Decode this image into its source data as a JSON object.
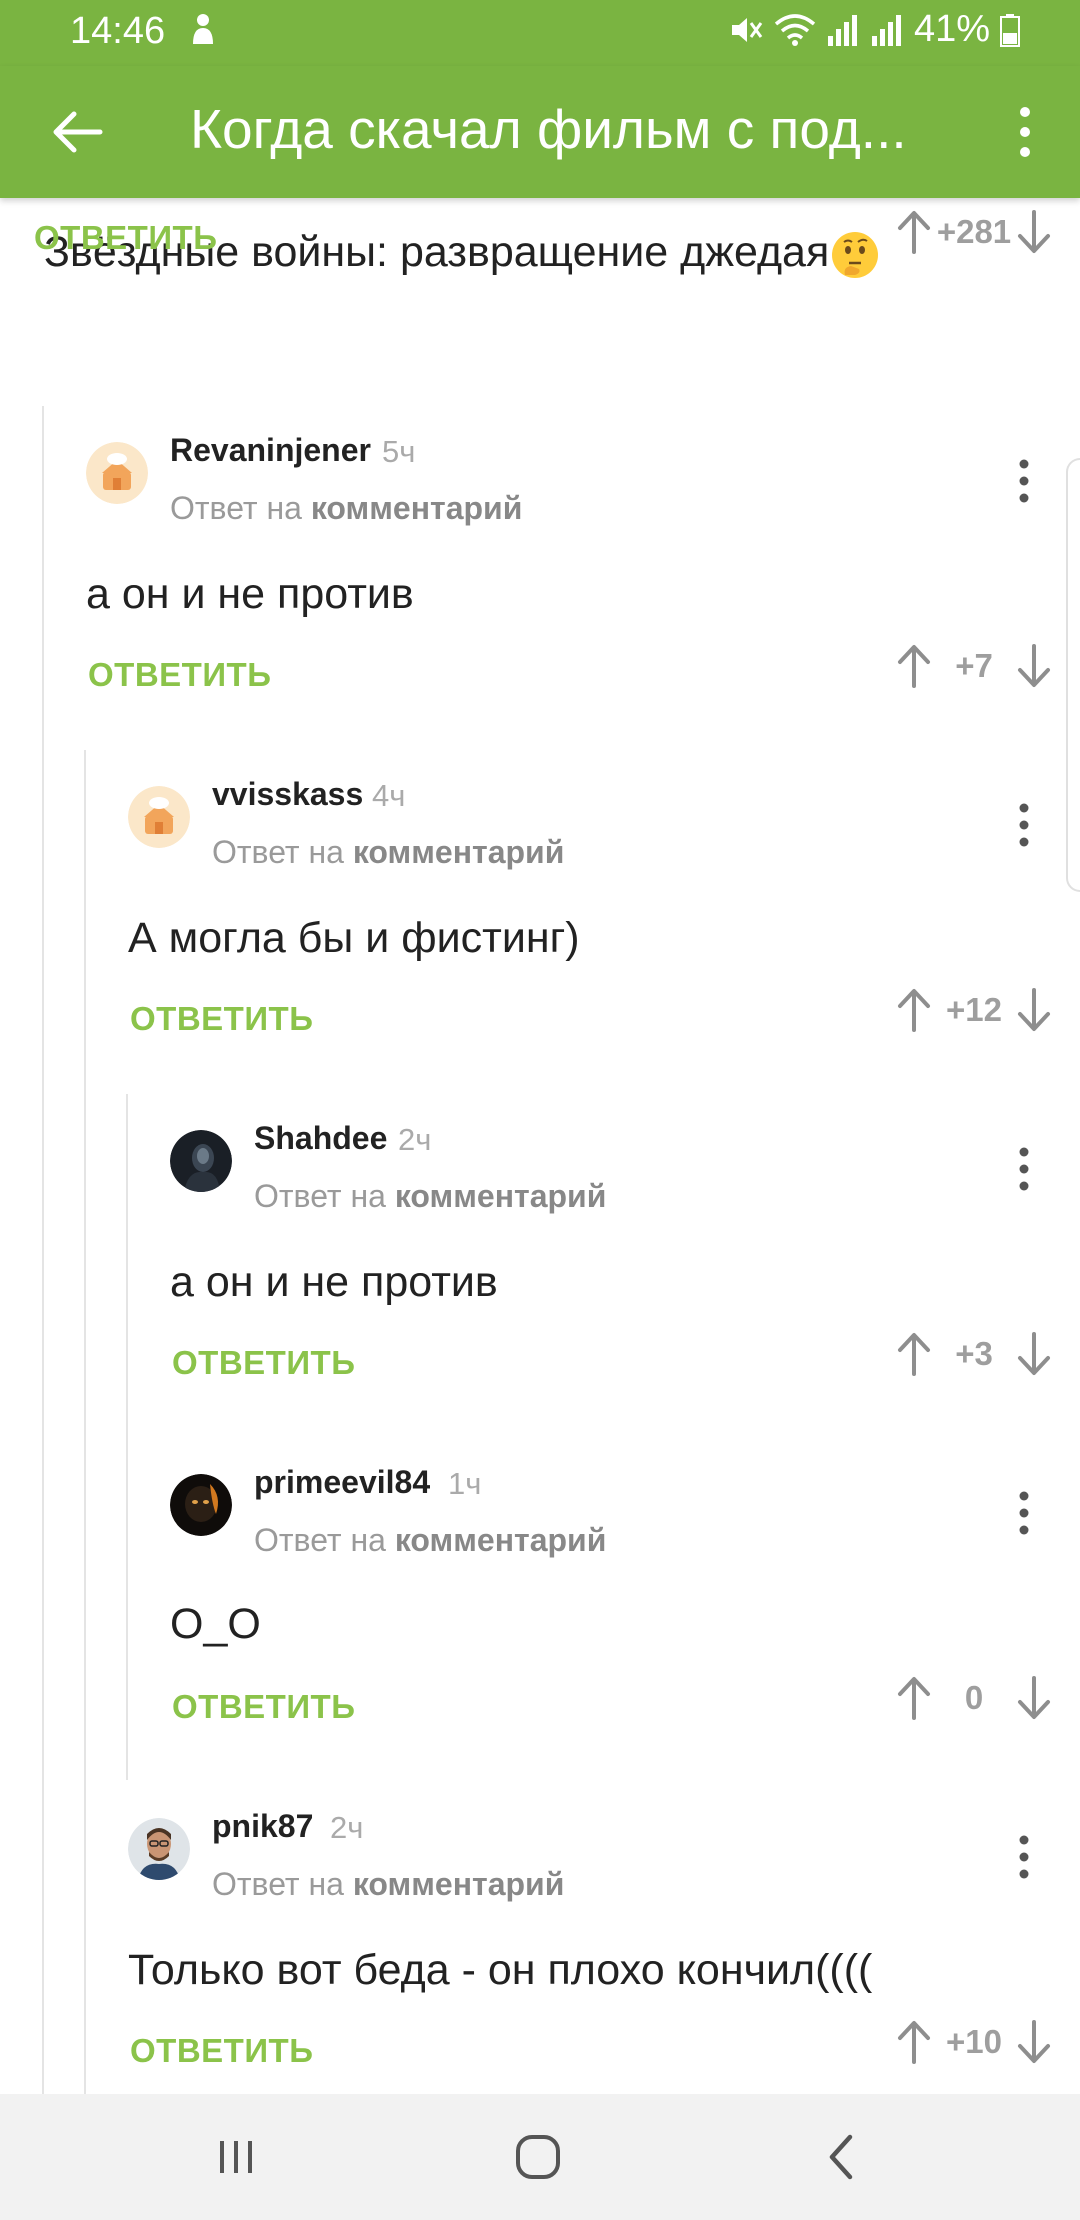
{
  "status_bar": {
    "time": "14:46",
    "battery": "41%"
  },
  "app_bar": {
    "title": "Когда скачал фильм с под..."
  },
  "post": {
    "text": "Звёздные войны: развращение джедая",
    "reply_label": "ОТВЕТИТЬ",
    "score": "+281"
  },
  "comments": [
    {
      "author": "Revaninjener",
      "ago": "5ч",
      "reply_prefix": "Ответ на",
      "reply_link": "комментарий",
      "text": "а он и не против",
      "reply_label": "ОТВЕТИТЬ",
      "score": "+7"
    },
    {
      "author": "vvisskass",
      "ago": "4ч",
      "reply_prefix": "Ответ на",
      "reply_link": "комментарий",
      "text": "А могла бы и фистинг)",
      "reply_label": "ОТВЕТИТЬ",
      "score": "+12"
    },
    {
      "author": "Shahdee",
      "ago": "2ч",
      "reply_prefix": "Ответ на",
      "reply_link": "комментарий",
      "text": "а он и не против",
      "reply_label": "ОТВЕТИТЬ",
      "score": "+3"
    },
    {
      "author": "primeevil84",
      "ago": "1ч",
      "reply_prefix": "Ответ на",
      "reply_link": "комментарий",
      "text": "O_O",
      "reply_label": "ОТВЕТИТЬ",
      "score": "0"
    },
    {
      "author": "pnik87",
      "ago": "2ч",
      "reply_prefix": "Ответ на",
      "reply_link": "комментарий",
      "text": "Только вот беда - он плохо кончил((((",
      "reply_label": "ОТВЕТИТЬ",
      "score": "+10"
    }
  ],
  "colors": {
    "accent": "#7ab441",
    "reply_text": "#8bc34a",
    "muted": "#9e9e9e"
  },
  "icons": {
    "back": "arrow-left-icon",
    "more": "more-vert-icon",
    "upvote": "arrow-up-icon",
    "downvote": "arrow-down-icon"
  }
}
